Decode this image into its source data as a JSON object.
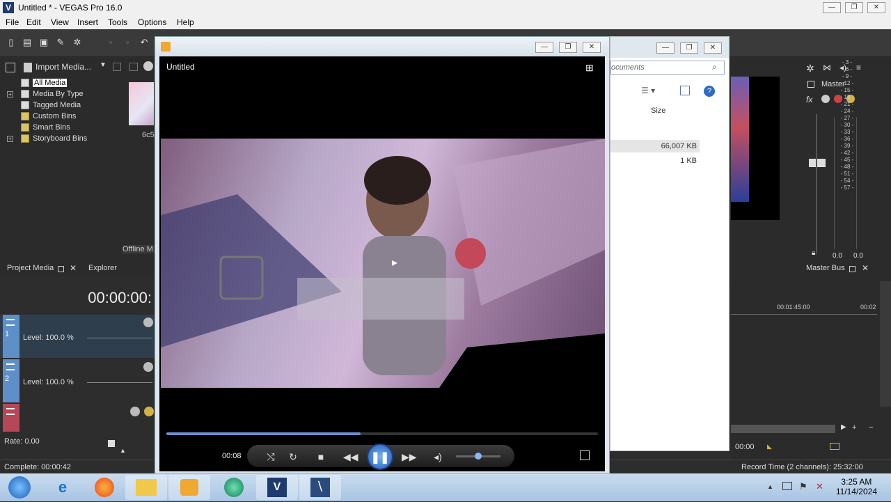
{
  "window": {
    "title": "Untitled * - VEGAS Pro 16.0"
  },
  "menu": [
    "File",
    "Edit",
    "View",
    "Insert",
    "Tools",
    "Options",
    "Help"
  ],
  "project_media": {
    "import_label": "Import Media...",
    "tree": [
      {
        "label": "All Media",
        "selected": true,
        "expandable": false
      },
      {
        "label": "Media By Type",
        "selected": false,
        "expandable": true
      },
      {
        "label": "Tagged Media",
        "selected": false,
        "expandable": false
      },
      {
        "label": "Custom Bins",
        "selected": false,
        "expandable": false
      },
      {
        "label": "Smart Bins",
        "selected": false,
        "expandable": false
      },
      {
        "label": "Storyboard Bins",
        "selected": false,
        "expandable": true
      }
    ],
    "thumb_caption": "6c5",
    "offline_label": "Offline M"
  },
  "tabs": {
    "project_media": "Project Media",
    "explorer": "Explorer"
  },
  "timeline": {
    "timecode": "00:00:00:",
    "tracks": [
      {
        "num": "1",
        "level": "Level: 100.0 %",
        "color": "#5f8fc9"
      },
      {
        "num": "2",
        "level": "Level: 100.0 %",
        "color": "#5f8fc9"
      },
      {
        "num": "",
        "level": "",
        "color": "#b54758"
      }
    ],
    "rate": "Rate: 0.00",
    "right_time": "00:01:45:00",
    "right_time2": "00:02",
    "right_end_time": "00:00"
  },
  "status": {
    "complete": "Complete: 00:00:42",
    "record": "Record Time (2 channels): 25:32:00"
  },
  "explorer": {
    "search_placeholder": "ocuments",
    "col_size": "Size",
    "sizes": [
      "66,007 KB",
      "1 KB"
    ]
  },
  "master": {
    "title": "Master",
    "bus_label": "Master Bus",
    "scale": [
      "3",
      "6",
      "9",
      "12",
      "15",
      "18",
      "21",
      "24",
      "27",
      "30",
      "33",
      "36",
      "39",
      "42",
      "45",
      "48",
      "51",
      "54",
      "57"
    ],
    "readout_left": "0.0",
    "readout_right": "0.0"
  },
  "player": {
    "title": "Untitled",
    "current_time": "00:08",
    "progress": 0.45,
    "volume": 0.5
  },
  "taskbar": {
    "time": "3:25 AM",
    "date": "11/14/2024"
  }
}
